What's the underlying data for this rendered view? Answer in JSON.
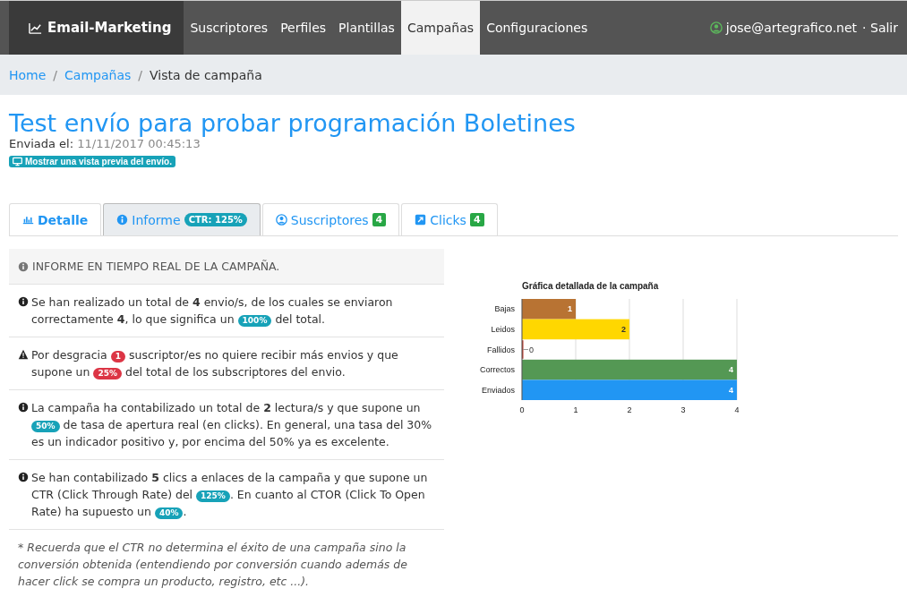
{
  "navbar": {
    "brand": "Email-Marketing",
    "items": [
      {
        "label": "Suscriptores",
        "selected": false
      },
      {
        "label": "Perfiles",
        "selected": false
      },
      {
        "label": "Plantillas",
        "selected": false
      },
      {
        "label": "Campañas",
        "selected": true
      },
      {
        "label": "Configuraciones",
        "selected": false
      }
    ],
    "user": "jose@artegrafico.net",
    "logout": "· Salir"
  },
  "breadcrumb": [
    {
      "label": "Home",
      "kind": "link"
    },
    {
      "separator": "/",
      "label": "Campañas",
      "kind": "link"
    },
    {
      "separator": "/",
      "label": "Vista de campaña",
      "kind": "current"
    }
  ],
  "title": "Test envío para probar programación Boletines",
  "sent_label": "Enviada el:",
  "sent_date": "11/11/2017 00:45:13",
  "preview_button": "Mostrar una vista previa del envío.",
  "tabs": [
    {
      "label": "Detalle",
      "selected": false
    },
    {
      "label": "Informe",
      "badge": "CTR: 125%",
      "selected": true
    },
    {
      "label": "Suscriptores",
      "badge": "4",
      "selected": false
    },
    {
      "label": "Clicks",
      "badge": "4",
      "selected": false
    }
  ],
  "report": {
    "header": "INFORME EN TIEMPO REAL DE LA CAMPAÑA.",
    "paragraphs": [
      {
        "kind": "info",
        "segments": [
          {
            "kind": "text",
            "text": "Se han realizado un total de **4** envio/s, de los cuales se enviaron correctamente **4**, lo que significa un"
          },
          {
            "kind": "info-badge",
            "text": "100%"
          },
          {
            "kind": "text",
            "text": "del total."
          }
        ]
      },
      {
        "kind": "warning",
        "segments": [
          {
            "kind": "text",
            "text": "Por desgracia"
          },
          {
            "kind": "danger-badge",
            "text": "1"
          },
          {
            "kind": "text",
            "text": "suscriptor/es no quiere recibir más envios y que supone un"
          },
          {
            "kind": "danger-badge",
            "text": "25%"
          },
          {
            "kind": "text",
            "text": "del total de los subscriptores del envio."
          }
        ]
      },
      {
        "kind": "info",
        "segments": [
          {
            "kind": "text",
            "text": "La campaña ha contabilizado un total de **2** lectura/s y que supone un"
          },
          {
            "kind": "info-badge",
            "text": "50%"
          },
          {
            "kind": "text",
            "text": "de tasa de apertura real (en clicks). En general, una tasa del 30% es un indicador positivo y, por encima del 50% ya es excelente."
          }
        ]
      },
      {
        "kind": "info",
        "segments": [
          {
            "kind": "text",
            "text": "Se han contabilizado **5** clics a enlaces de la campaña y que supone un CTR (Click Through Rate) del"
          },
          {
            "kind": "info-badge",
            "text": "125%"
          },
          {
            "kind": "text",
            "text": ". En cuanto al CTOR (Click To Open Rate) ha supuesto un"
          },
          {
            "kind": "info-badge",
            "text": "40%"
          },
          {
            "kind": "text",
            "text": "."
          }
        ]
      }
    ],
    "note": "* Recuerda que el CTR no determina el éxito de una campaña sino la conversión obtenida (entendiendo por conversión cuando además de hacer click se compra un producto, registro, etc ...)."
  },
  "chart": {
    "chart_data": {
      "type": "bar",
      "orientation": "horizontal",
      "title": "Gráfica detallada de la campaña",
      "data_labels": true,
      "grid": true,
      "categories": [
        "Bajas",
        "Leidos",
        "Fallidos",
        "Correctos",
        "Enviados"
      ],
      "values": [
        1,
        2,
        0,
        4,
        4
      ],
      "colors": [
        "#b87333",
        "#ffd700",
        "#c0392b",
        "#549854",
        "#2196f3"
      ],
      "xlim": [
        0,
        4
      ],
      "xticks": [
        0,
        1,
        2,
        3,
        4
      ]
    }
  }
}
